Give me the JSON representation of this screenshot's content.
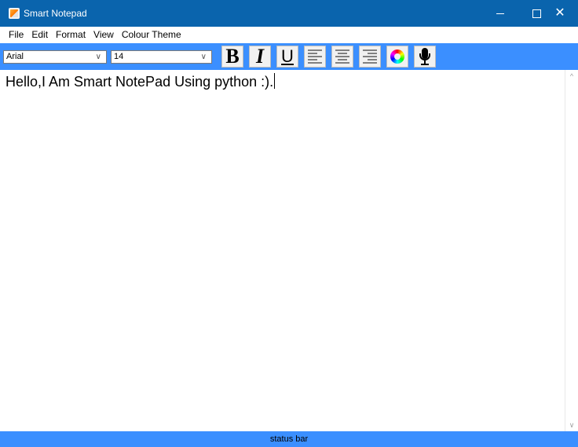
{
  "window": {
    "title": "Smart Notepad",
    "app_icon": "notepad-icon",
    "controls": {
      "minimize": "minimize-icon",
      "maximize": "maximize-icon",
      "close_glyph": "✕"
    }
  },
  "menu": {
    "items": [
      {
        "label": "File"
      },
      {
        "label": "Edit"
      },
      {
        "label": "Format"
      },
      {
        "label": "View"
      },
      {
        "label": "Colour Theme"
      }
    ]
  },
  "toolbar": {
    "font_family": {
      "value": "Arial"
    },
    "font_size": {
      "value": "14"
    },
    "dropdown_glyph": "∨",
    "buttons": {
      "bold": "B",
      "italic": "I",
      "underline": "U",
      "align_left": "align-left-icon",
      "align_center": "align-center-icon",
      "align_right": "align-right-icon",
      "colour": "colour-wheel-icon",
      "microphone": "microphone-icon"
    },
    "background_color": "#3b8fff"
  },
  "editor": {
    "content": "Hello,I Am Smart NotePad Using python :)."
  },
  "scrollbar": {
    "up_glyph": "^",
    "down_glyph": "∨"
  },
  "status_bar": {
    "text": "status bar",
    "background_color": "#3b8fff"
  },
  "colors": {
    "title_bar": "#0a64ad",
    "toolbar": "#3b8fff"
  }
}
